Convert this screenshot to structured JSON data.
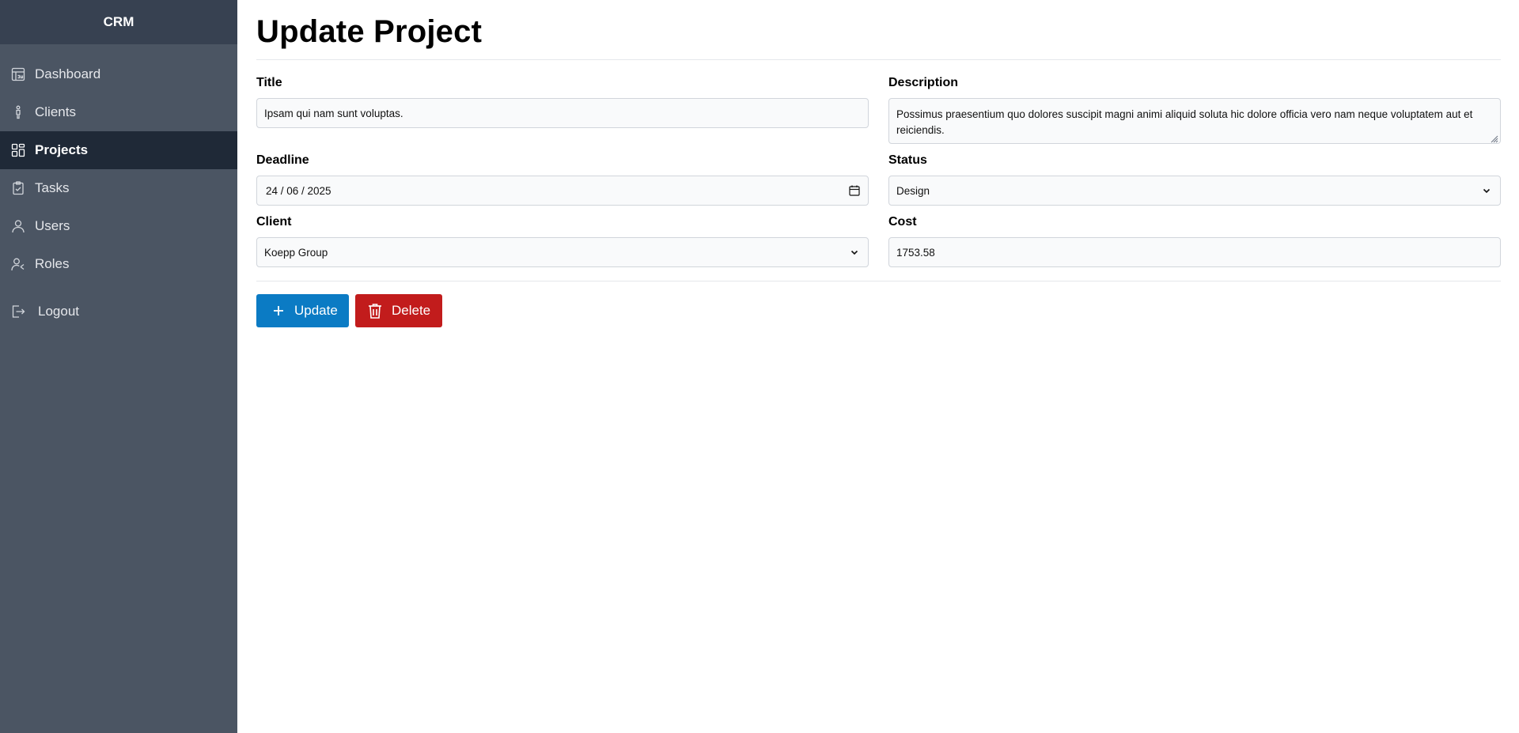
{
  "app": {
    "brand": "CRM"
  },
  "sidebar": {
    "items": [
      {
        "label": "Dashboard",
        "icon": "dashboard-icon",
        "active": false
      },
      {
        "label": "Clients",
        "icon": "person-icon",
        "active": false
      },
      {
        "label": "Projects",
        "icon": "projects-icon",
        "active": true
      },
      {
        "label": "Tasks",
        "icon": "clipboard-icon",
        "active": false
      },
      {
        "label": "Users",
        "icon": "user-icon",
        "active": false
      },
      {
        "label": "Roles",
        "icon": "roles-icon",
        "active": false
      }
    ],
    "logout": {
      "label": "Logout",
      "icon": "logout-icon"
    }
  },
  "page": {
    "title": "Update Project"
  },
  "form": {
    "title": {
      "label": "Title",
      "value": "Ipsam qui nam sunt voluptas."
    },
    "description": {
      "label": "Description",
      "value": "Possimus praesentium quo dolores suscipit magni animi aliquid soluta hic dolore officia vero nam neque voluptatem aut et reiciendis."
    },
    "deadline": {
      "label": "Deadline",
      "value": "24 / 06 / 2025"
    },
    "status": {
      "label": "Status",
      "value": "Design"
    },
    "client": {
      "label": "Client",
      "value": "Koepp Group"
    },
    "cost": {
      "label": "Cost",
      "value": "1753.58"
    }
  },
  "actions": {
    "update_label": "Update",
    "delete_label": "Delete"
  },
  "colors": {
    "sidebar_bg": "#4b5563",
    "sidebar_brand_bg": "#374151",
    "sidebar_active_bg": "#1f2937",
    "update_button": "#0b7bc4",
    "delete_button": "#c21c1c"
  }
}
